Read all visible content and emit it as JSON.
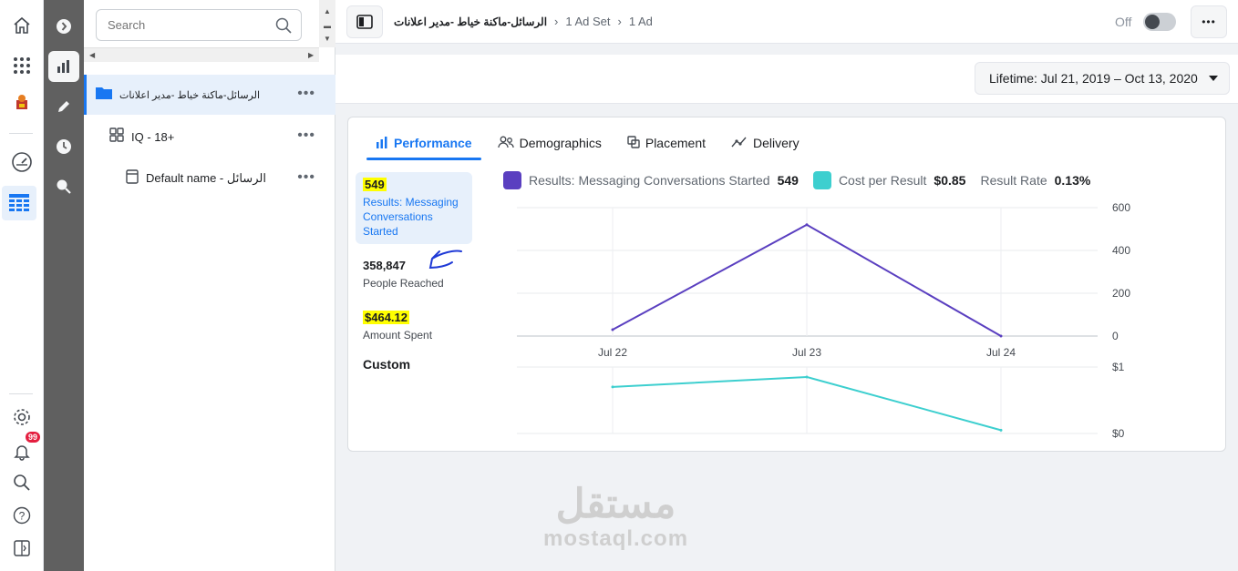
{
  "global_nav": {
    "notification_count": "99"
  },
  "tree": {
    "search_placeholder": "Search",
    "items": [
      {
        "label": "الرسائل-ماكنة خياط -مدير اعلانات",
        "more": "•••"
      },
      {
        "label": "IQ - 18+",
        "more": "•••"
      },
      {
        "label": "Default name - الرسائل",
        "more": "•••"
      }
    ]
  },
  "breadcrumbs": {
    "campaign": "الرسائل-ماكنة خياط -مدير اعلانات",
    "adset": "1 Ad Set",
    "ad": "1 Ad"
  },
  "topbar": {
    "toggle_label": "Off",
    "toggle_on": false,
    "more_label": "•••"
  },
  "date_range": {
    "label": "Lifetime: Jul 21, 2019 – Oct 13, 2020"
  },
  "tabs": [
    {
      "label": "Performance",
      "icon": "bar-chart-icon",
      "active": true
    },
    {
      "label": "Demographics",
      "icon": "people-icon",
      "active": false
    },
    {
      "label": "Placement",
      "icon": "placement-icon",
      "active": false
    },
    {
      "label": "Delivery",
      "icon": "delivery-icon",
      "active": false
    }
  ],
  "metrics": [
    {
      "value": "549",
      "label": "Results: Messaging Conversations Started",
      "highlighted": true,
      "selected": true
    },
    {
      "value": "358,847",
      "label": "People Reached",
      "highlighted": false,
      "selected": false
    },
    {
      "value": "$464.12",
      "label": "Amount Spent",
      "highlighted": true,
      "selected": false
    }
  ],
  "custom_label": "Custom",
  "legend": {
    "results_label": "Results: Messaging Conversations Started",
    "results_value": "549",
    "cost_label": "Cost per Result",
    "cost_value": "$0.85",
    "rate_label": "Result Rate",
    "rate_value": "0.13%"
  },
  "colors": {
    "results": "#5a3fc0",
    "cost": "#3dcfcf",
    "accent": "#1877f2",
    "highlight": "#ffff00"
  },
  "chart_data": [
    {
      "type": "line",
      "x": [
        "Jul 22",
        "Jul 23",
        "Jul 24"
      ],
      "series": [
        {
          "name": "Results: Messaging Conversations Started",
          "values": [
            30,
            520,
            0
          ],
          "color": "#5a3fc0"
        }
      ],
      "yticks": [
        "600",
        "400",
        "200",
        "0"
      ],
      "ylim": [
        0,
        600
      ],
      "grid": true
    },
    {
      "type": "line",
      "x": [
        "Jul 22",
        "Jul 23",
        "Jul 24"
      ],
      "series": [
        {
          "name": "Cost per Result",
          "values": [
            0.7,
            0.85,
            0.05
          ],
          "color": "#3dcfcf"
        }
      ],
      "yticks": [
        "$1",
        "$0"
      ],
      "ylim": [
        0,
        1
      ],
      "grid": true
    }
  ],
  "watermark": {
    "arabic": "مستقل",
    "latin": "mostaql.com"
  }
}
